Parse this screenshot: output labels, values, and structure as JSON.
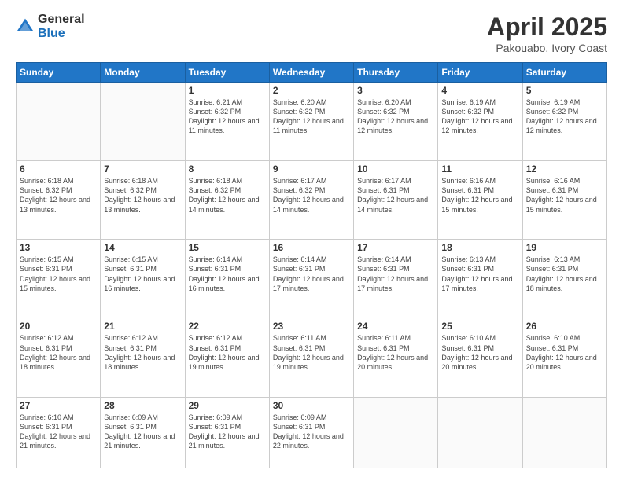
{
  "logo": {
    "general": "General",
    "blue": "Blue"
  },
  "title": "April 2025",
  "subtitle": "Pakouabo, Ivory Coast",
  "weekdays": [
    "Sunday",
    "Monday",
    "Tuesday",
    "Wednesday",
    "Thursday",
    "Friday",
    "Saturday"
  ],
  "weeks": [
    [
      {
        "day": "",
        "info": ""
      },
      {
        "day": "",
        "info": ""
      },
      {
        "day": "1",
        "info": "Sunrise: 6:21 AM\nSunset: 6:32 PM\nDaylight: 12 hours and 11 minutes."
      },
      {
        "day": "2",
        "info": "Sunrise: 6:20 AM\nSunset: 6:32 PM\nDaylight: 12 hours and 11 minutes."
      },
      {
        "day": "3",
        "info": "Sunrise: 6:20 AM\nSunset: 6:32 PM\nDaylight: 12 hours and 12 minutes."
      },
      {
        "day": "4",
        "info": "Sunrise: 6:19 AM\nSunset: 6:32 PM\nDaylight: 12 hours and 12 minutes."
      },
      {
        "day": "5",
        "info": "Sunrise: 6:19 AM\nSunset: 6:32 PM\nDaylight: 12 hours and 12 minutes."
      }
    ],
    [
      {
        "day": "6",
        "info": "Sunrise: 6:18 AM\nSunset: 6:32 PM\nDaylight: 12 hours and 13 minutes."
      },
      {
        "day": "7",
        "info": "Sunrise: 6:18 AM\nSunset: 6:32 PM\nDaylight: 12 hours and 13 minutes."
      },
      {
        "day": "8",
        "info": "Sunrise: 6:18 AM\nSunset: 6:32 PM\nDaylight: 12 hours and 14 minutes."
      },
      {
        "day": "9",
        "info": "Sunrise: 6:17 AM\nSunset: 6:32 PM\nDaylight: 12 hours and 14 minutes."
      },
      {
        "day": "10",
        "info": "Sunrise: 6:17 AM\nSunset: 6:31 PM\nDaylight: 12 hours and 14 minutes."
      },
      {
        "day": "11",
        "info": "Sunrise: 6:16 AM\nSunset: 6:31 PM\nDaylight: 12 hours and 15 minutes."
      },
      {
        "day": "12",
        "info": "Sunrise: 6:16 AM\nSunset: 6:31 PM\nDaylight: 12 hours and 15 minutes."
      }
    ],
    [
      {
        "day": "13",
        "info": "Sunrise: 6:15 AM\nSunset: 6:31 PM\nDaylight: 12 hours and 15 minutes."
      },
      {
        "day": "14",
        "info": "Sunrise: 6:15 AM\nSunset: 6:31 PM\nDaylight: 12 hours and 16 minutes."
      },
      {
        "day": "15",
        "info": "Sunrise: 6:14 AM\nSunset: 6:31 PM\nDaylight: 12 hours and 16 minutes."
      },
      {
        "day": "16",
        "info": "Sunrise: 6:14 AM\nSunset: 6:31 PM\nDaylight: 12 hours and 17 minutes."
      },
      {
        "day": "17",
        "info": "Sunrise: 6:14 AM\nSunset: 6:31 PM\nDaylight: 12 hours and 17 minutes."
      },
      {
        "day": "18",
        "info": "Sunrise: 6:13 AM\nSunset: 6:31 PM\nDaylight: 12 hours and 17 minutes."
      },
      {
        "day": "19",
        "info": "Sunrise: 6:13 AM\nSunset: 6:31 PM\nDaylight: 12 hours and 18 minutes."
      }
    ],
    [
      {
        "day": "20",
        "info": "Sunrise: 6:12 AM\nSunset: 6:31 PM\nDaylight: 12 hours and 18 minutes."
      },
      {
        "day": "21",
        "info": "Sunrise: 6:12 AM\nSunset: 6:31 PM\nDaylight: 12 hours and 18 minutes."
      },
      {
        "day": "22",
        "info": "Sunrise: 6:12 AM\nSunset: 6:31 PM\nDaylight: 12 hours and 19 minutes."
      },
      {
        "day": "23",
        "info": "Sunrise: 6:11 AM\nSunset: 6:31 PM\nDaylight: 12 hours and 19 minutes."
      },
      {
        "day": "24",
        "info": "Sunrise: 6:11 AM\nSunset: 6:31 PM\nDaylight: 12 hours and 20 minutes."
      },
      {
        "day": "25",
        "info": "Sunrise: 6:10 AM\nSunset: 6:31 PM\nDaylight: 12 hours and 20 minutes."
      },
      {
        "day": "26",
        "info": "Sunrise: 6:10 AM\nSunset: 6:31 PM\nDaylight: 12 hours and 20 minutes."
      }
    ],
    [
      {
        "day": "27",
        "info": "Sunrise: 6:10 AM\nSunset: 6:31 PM\nDaylight: 12 hours and 21 minutes."
      },
      {
        "day": "28",
        "info": "Sunrise: 6:09 AM\nSunset: 6:31 PM\nDaylight: 12 hours and 21 minutes."
      },
      {
        "day": "29",
        "info": "Sunrise: 6:09 AM\nSunset: 6:31 PM\nDaylight: 12 hours and 21 minutes."
      },
      {
        "day": "30",
        "info": "Sunrise: 6:09 AM\nSunset: 6:31 PM\nDaylight: 12 hours and 22 minutes."
      },
      {
        "day": "",
        "info": ""
      },
      {
        "day": "",
        "info": ""
      },
      {
        "day": "",
        "info": ""
      }
    ]
  ]
}
